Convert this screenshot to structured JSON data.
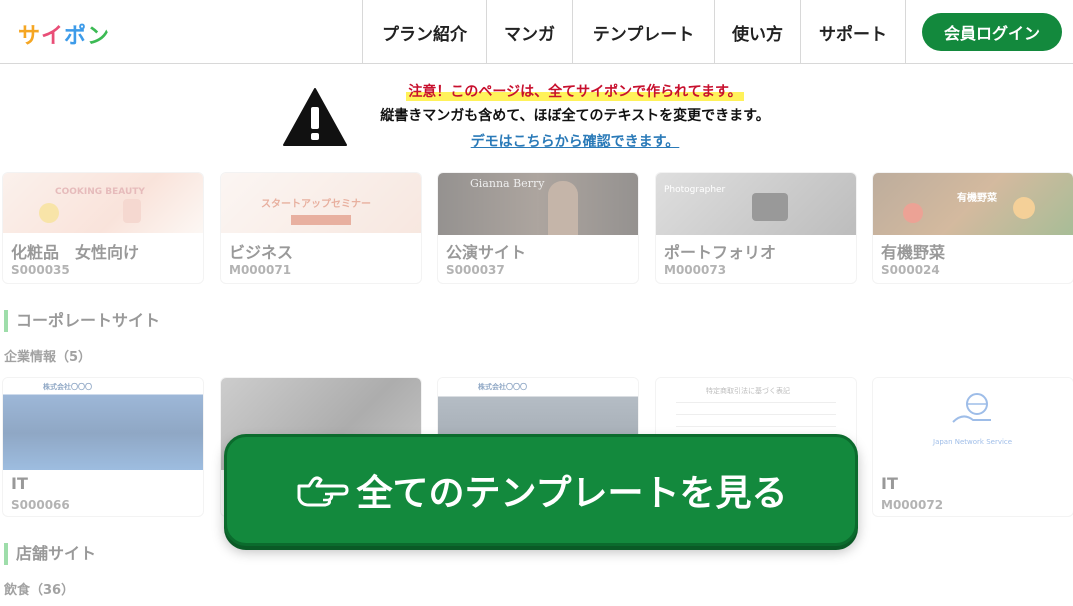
{
  "header": {
    "logo": [
      "サ",
      "イ",
      "ポ",
      "ン"
    ],
    "logo_colors": [
      "#f5a623",
      "#e94e77",
      "#3d9be9",
      "#3cba54"
    ],
    "nav": [
      "プラン紹介",
      "マンガ",
      "テンプレート",
      "使い方",
      "サポート"
    ],
    "login": "会員ログイン"
  },
  "notice": {
    "warning": "注意！このページは、全てサイポンで作られてます。",
    "text": "縦書きマンガも含めて、ほぼ全てのテキストを変更できます。",
    "link": "デモはこちらから確認できます。"
  },
  "row1": [
    {
      "title": "化粧品　女性向け",
      "code": "S000035",
      "thumb_text": "COOKING BEAUTY"
    },
    {
      "title": "ビジネス",
      "code": "M000071",
      "thumb_text": "スタートアップセミナー"
    },
    {
      "title": "公演サイト",
      "code": "S000037",
      "thumb_text": "Gianna Berry"
    },
    {
      "title": "ポートフォリオ",
      "code": "M000073",
      "thumb_text": "Photographer"
    },
    {
      "title": "有機野菜",
      "code": "S000024",
      "thumb_text": "有機野菜"
    }
  ],
  "section1": {
    "heading": "コーポレートサイト",
    "sub": "企業情報（5）"
  },
  "row2": [
    {
      "title": "IT",
      "code": "S000066",
      "thumb_text": "株式会社〇〇〇"
    },
    {
      "title": "",
      "code": "",
      "thumb_text": ""
    },
    {
      "title": "",
      "code": "",
      "thumb_text": "株式会社〇〇〇"
    },
    {
      "title": "",
      "code": "",
      "thumb_text": "特定商取引法に基づく表記"
    },
    {
      "title": "IT",
      "code": "M000072",
      "thumb_text": "Japan Network Service"
    }
  ],
  "section2": {
    "heading": "店舗サイト",
    "sub": "飲食（36）"
  },
  "cta": {
    "label": "全てのテンプレートを見る",
    "icon": "pointing-hand-icon"
  },
  "colors": {
    "brand_green": "#13893d",
    "warning_red": "#c8102e",
    "link_blue": "#2a7ab8",
    "highlight": "#fff25a"
  }
}
